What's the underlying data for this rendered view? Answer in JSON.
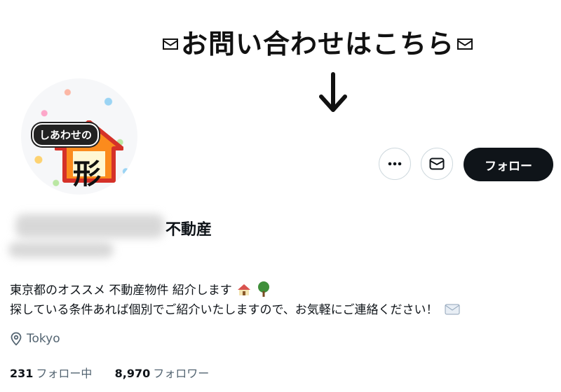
{
  "banner": {
    "text": "お問い合わせはこちら"
  },
  "avatar": {
    "top_text": "しあわせの",
    "big_text": "形"
  },
  "actions": {
    "follow_label": "フォロー"
  },
  "profile": {
    "display_name_suffix": "不動産"
  },
  "bio": {
    "line1": "東京都のオススメ 不動産物件 紹介します",
    "line2": "探している条件あれば個別でご紹介いたしますので、お気軽にご連絡ください！"
  },
  "location": {
    "text": "Tokyo"
  },
  "stats": {
    "following_count": "231",
    "following_label": "フォロー中",
    "followers_count": "8,970",
    "followers_label": "フォロワー"
  },
  "icons": [
    "envelope-icon",
    "arrow-down-icon",
    "more-icon",
    "mail-icon",
    "location-pin-icon",
    "house-emoji-icon",
    "tree-emoji-icon",
    "envelope-emoji-icon"
  ],
  "colors": {
    "primary_text": "#0f1419",
    "secondary_text": "#536471",
    "button_dark": "#0f1419",
    "border": "#cfd9de"
  }
}
